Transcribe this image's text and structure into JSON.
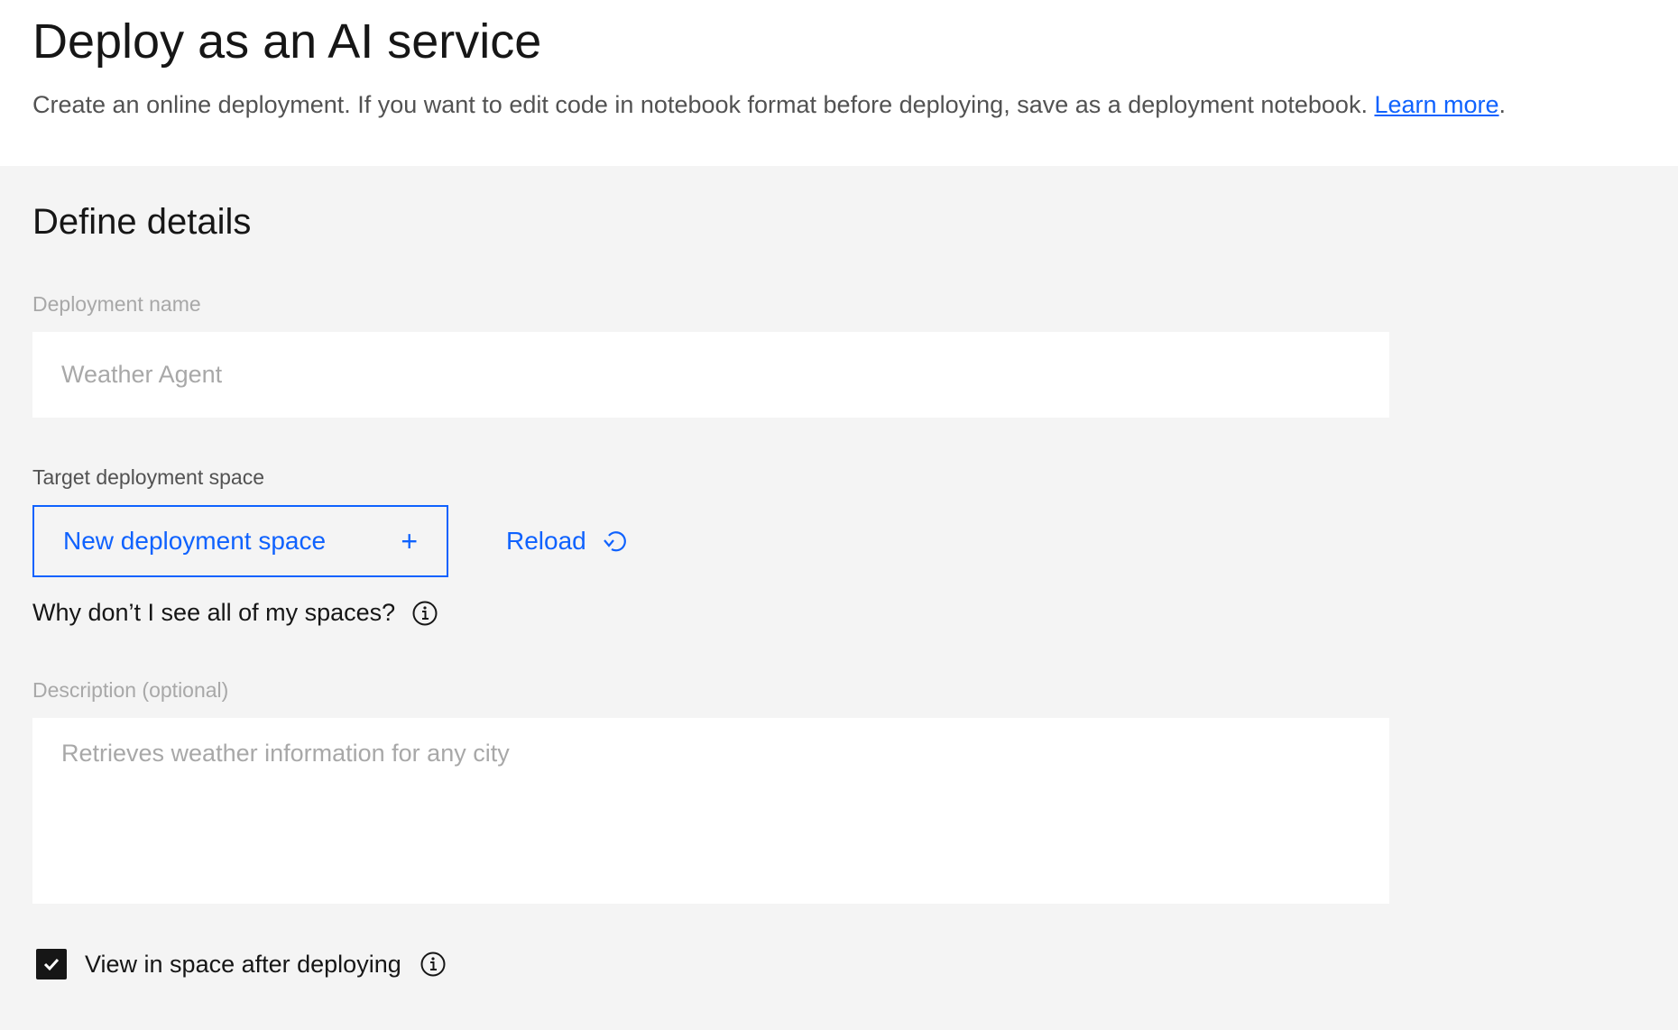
{
  "header": {
    "title": "Deploy as an AI service",
    "subtitle": "Create an online deployment. If you want to edit code in notebook format before deploying, save as a deployment notebook.",
    "learn_more_link": "Learn more",
    "subtitle_end": "."
  },
  "form": {
    "section_title": "Define details",
    "deployment_name": {
      "label": "Deployment name",
      "placeholder": "Weather Agent",
      "value": ""
    },
    "target_space": {
      "label": "Target deployment space",
      "new_space_button": "New deployment space",
      "new_space_icon": "plus-icon",
      "reload_button": "Reload",
      "reload_icon": "reload-icon",
      "help_text": "Why don’t I see all of my spaces?",
      "help_icon": "info-icon"
    },
    "description": {
      "label": "Description (optional)",
      "placeholder": "Retrieves weather information for any city",
      "value": ""
    },
    "view_after_deploy": {
      "label": "View in space after deploying",
      "checked": true,
      "icon": "info-icon"
    }
  },
  "colors": {
    "accent": "#0f62fe",
    "text_primary": "#161616",
    "text_secondary": "#525252",
    "text_disabled": "#a8a8a8",
    "background": "#f4f4f4",
    "field_background": "#ffffff"
  }
}
